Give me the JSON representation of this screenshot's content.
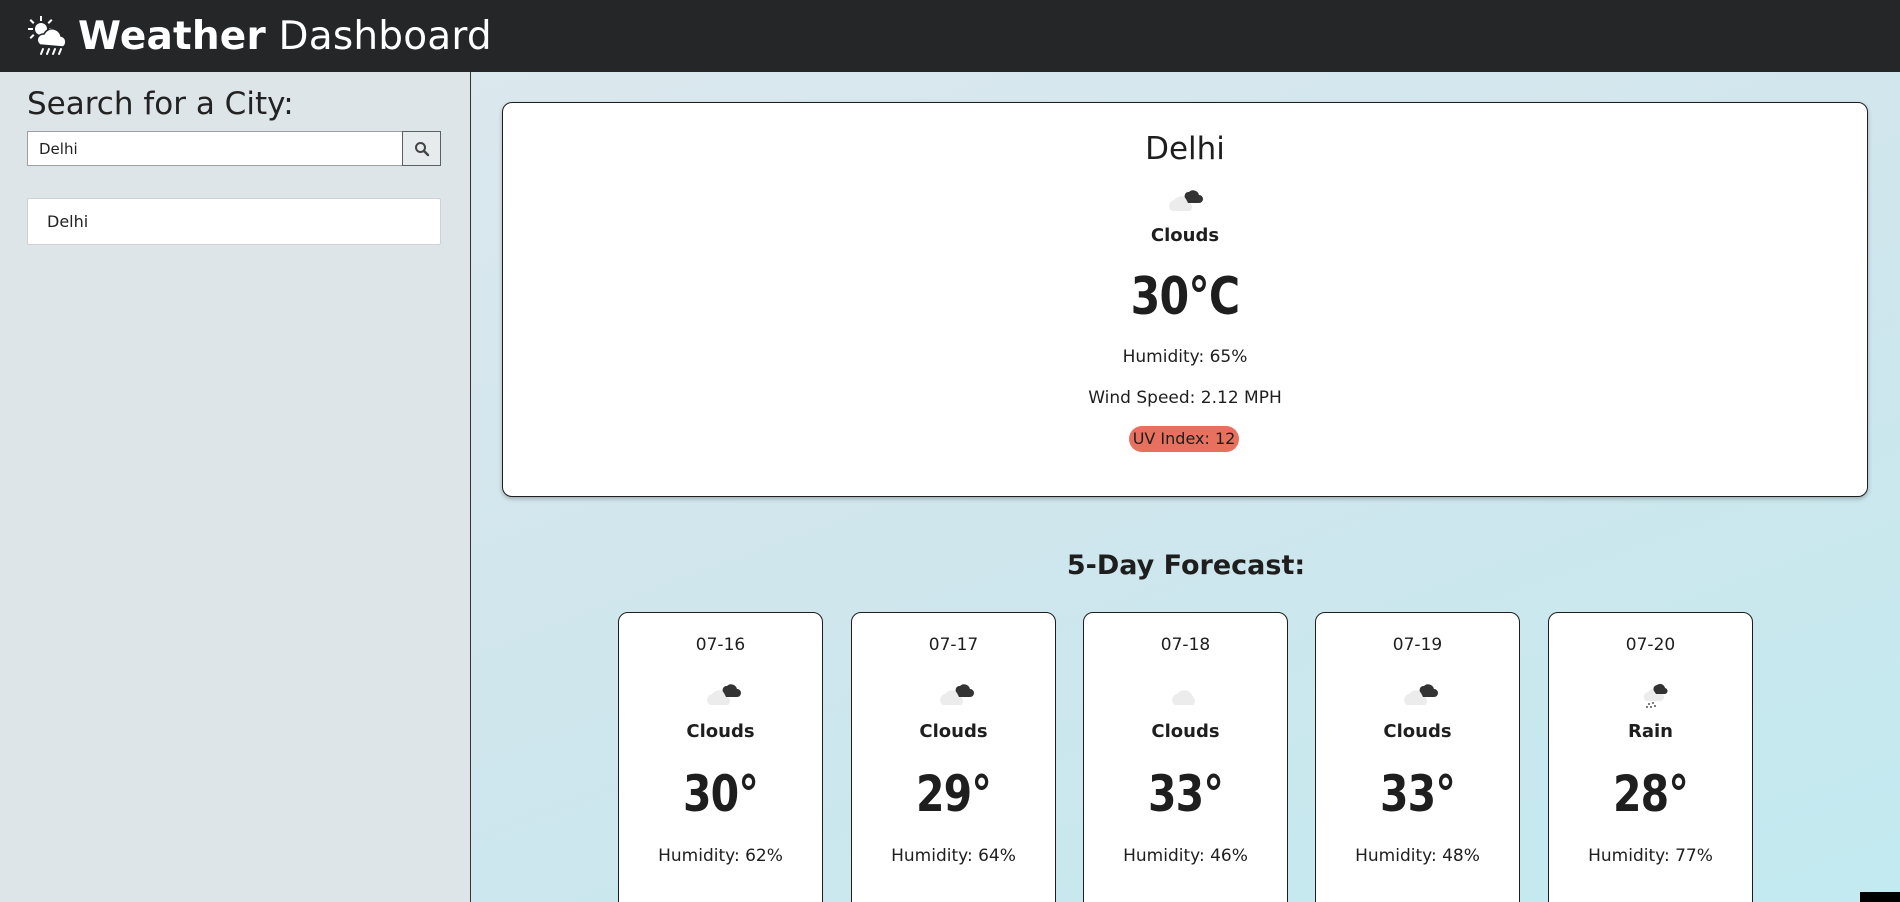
{
  "header": {
    "title_bold": "Weather",
    "title_rest": " Dashboard",
    "logo_icon": "sun-cloud-rain-icon"
  },
  "sidebar": {
    "search_heading": "Search for a City:",
    "search_value": "Delhi",
    "search_button_icon": "search-icon",
    "history": [
      "Delhi"
    ]
  },
  "current": {
    "city": "Delhi",
    "icon": "broken-clouds-icon",
    "condition": "Clouds",
    "temperature": "30°C",
    "humidity": "Humidity: 65%",
    "wind": "Wind Speed: 2.12 MPH",
    "uv": "UV Index: 12",
    "uv_color": "#e8705f"
  },
  "forecast": {
    "title": "5-Day Forecast:",
    "days": [
      {
        "date": "07-16",
        "icon": "broken-clouds-icon",
        "condition": "Clouds",
        "temp": "30°",
        "humidity": "Humidity: 62%"
      },
      {
        "date": "07-17",
        "icon": "broken-clouds-icon",
        "condition": "Clouds",
        "temp": "29°",
        "humidity": "Humidity: 64%"
      },
      {
        "date": "07-18",
        "icon": "scattered-clouds-icon",
        "condition": "Clouds",
        "temp": "33°",
        "humidity": "Humidity: 46%"
      },
      {
        "date": "07-19",
        "icon": "broken-clouds-icon",
        "condition": "Clouds",
        "temp": "33°",
        "humidity": "Humidity: 48%"
      },
      {
        "date": "07-20",
        "icon": "rain-icon",
        "condition": "Rain",
        "temp": "28°",
        "humidity": "Humidity: 77%"
      }
    ]
  },
  "colors": {
    "header_bg": "#242628",
    "sidebar_bg": "#dde5e9",
    "uv_badge": "#e8705f"
  }
}
